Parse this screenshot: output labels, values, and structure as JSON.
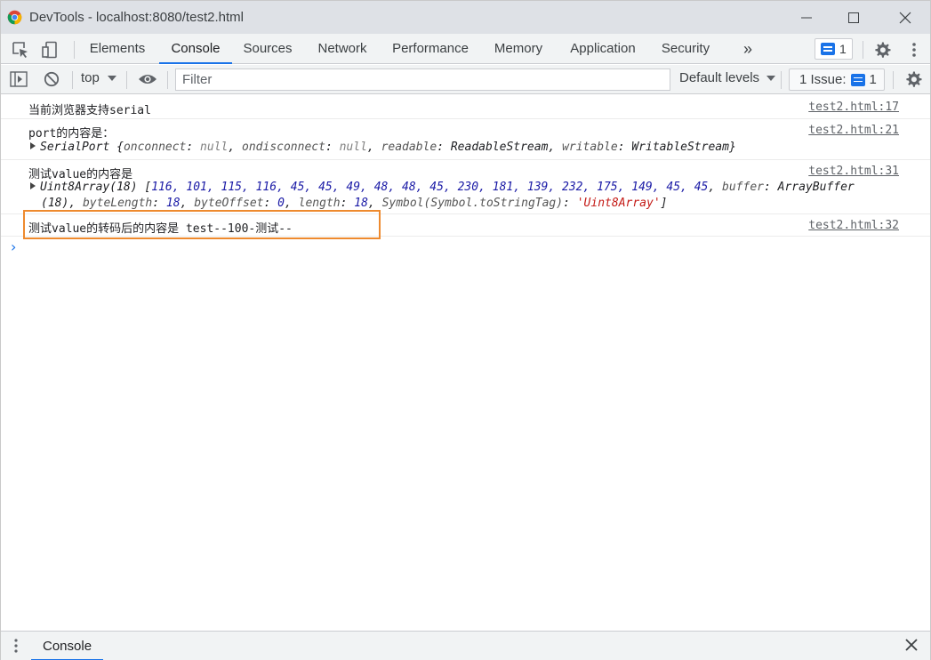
{
  "window": {
    "title": "DevTools - localhost:8080/test2.html"
  },
  "panel_tabs": [
    {
      "label": "Elements"
    },
    {
      "label": "Console"
    },
    {
      "label": "Sources"
    },
    {
      "label": "Network"
    },
    {
      "label": "Performance"
    },
    {
      "label": "Memory"
    },
    {
      "label": "Application"
    },
    {
      "label": "Security"
    }
  ],
  "active_tab": "Console",
  "more_tabs_glyph": "»",
  "messages_badge_count": "1",
  "toolbar": {
    "context": "top",
    "filter_placeholder": "Filter",
    "levels": "Default levels",
    "issues_label": "1 Issue:",
    "issues_count": "1"
  },
  "console": {
    "messages": [
      {
        "text": "当前浏览器支持serial",
        "source": "test2.html:17"
      },
      {
        "text": "port的内容是：",
        "source": "test2.html:21"
      },
      {
        "text": "测试value的内容是",
        "source": "test2.html:31"
      },
      {
        "text": "测试value的转码后的内容是 test--100-测试--",
        "source": "test2.html:32"
      }
    ],
    "serialport_line": {
      "class": "SerialPort",
      "k1": "onconnect",
      "v1": "null",
      "k2": "ondisconnect",
      "v2": "null",
      "k3": "readable",
      "v3": "ReadableStream",
      "k4": "writable",
      "v4": "WritableStream"
    },
    "uint8_line": {
      "class": "Uint8Array(18)",
      "values": "116, 101, 115, 116, 45, 45, 49, 48, 48, 45, 230, 181, 139, 232, 175, 149, 45, 45",
      "buffer_key": "buffer",
      "buffer_val": "ArrayBuffer",
      "buffer_len": "(18)",
      "bl_key": "byteLength",
      "bl_val": "18",
      "bo_key": "byteOffset",
      "bo_val": "0",
      "len_key": "length",
      "len_val": "18",
      "sym_key": "Symbol(Symbol.toStringTag)",
      "sym_val": "'Uint8Array'"
    },
    "prompt": "›"
  },
  "drawer": {
    "tab": "Console"
  },
  "colors": {
    "accent": "#1a73e8",
    "highlight": "#ee8a2e"
  }
}
